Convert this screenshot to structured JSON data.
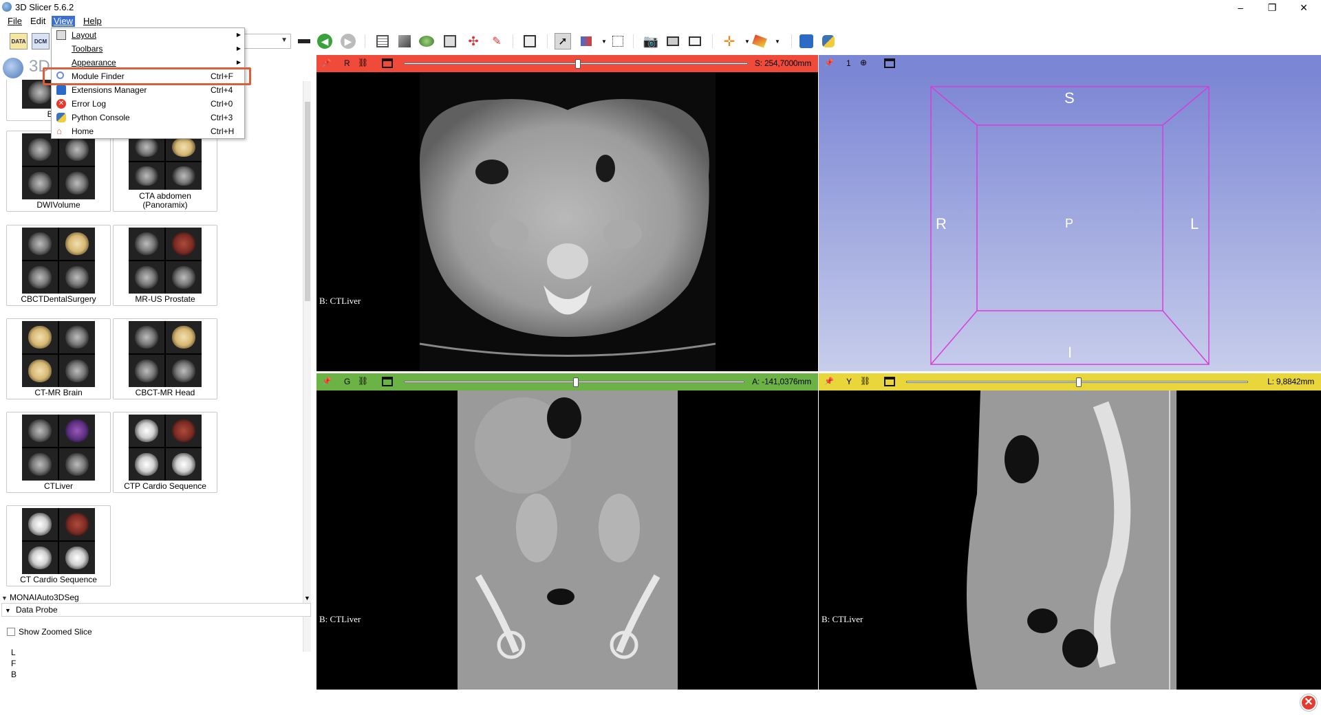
{
  "window": {
    "title": "3D Slicer 5.6.2",
    "minimize": "–",
    "maximize": "❐",
    "close": "✕"
  },
  "menubar": {
    "items": [
      {
        "label": "File"
      },
      {
        "label": "Edit"
      },
      {
        "label": "View"
      },
      {
        "label": "Help"
      }
    ]
  },
  "toolbar": {
    "data_icon": "DATA",
    "dcm_icon": "DCM"
  },
  "view_menu": {
    "items": [
      {
        "label": "Layout",
        "shortcut": "",
        "submenu": true,
        "icon": "layout-icon"
      },
      {
        "label": "Toolbars",
        "shortcut": "",
        "submenu": true,
        "icon": ""
      },
      {
        "label": "Appearance",
        "shortcut": "",
        "submenu": true,
        "icon": ""
      },
      {
        "label": "Module Finder",
        "shortcut": "Ctrl+F",
        "submenu": false,
        "icon": "search-icon"
      },
      {
        "label": "Extensions Manager",
        "shortcut": "Ctrl+4",
        "submenu": false,
        "icon": "extensions-icon"
      },
      {
        "label": "Error Log",
        "shortcut": "Ctrl+0",
        "submenu": false,
        "icon": "error-icon"
      },
      {
        "label": "Python Console",
        "shortcut": "Ctrl+3",
        "submenu": false,
        "icon": "python-icon"
      },
      {
        "label": "Home",
        "shortcut": "Ctrl+H",
        "submenu": false,
        "icon": "home-icon"
      }
    ]
  },
  "left_panel": {
    "module_title": "3D",
    "samples": [
      {
        "label": "Baseli"
      },
      {
        "label": "DWIVolume"
      },
      {
        "label": "CTA abdomen\n(Panoramix)"
      },
      {
        "label": "CBCTDentalSurgery"
      },
      {
        "label": "MR-US Prostate"
      },
      {
        "label": "CT-MR Brain"
      },
      {
        "label": "CBCT-MR Head"
      },
      {
        "label": "CTLiver"
      },
      {
        "label": "CTP Cardio Sequence"
      },
      {
        "label": "CT Cardio Sequence"
      }
    ],
    "monai_section": "MONAIAuto3DSeg",
    "data_probe": "Data Probe",
    "show_zoomed_slice": "Show Zoomed Slice",
    "probe_letters": [
      "L",
      "F",
      "B"
    ]
  },
  "viewers": {
    "red": {
      "letter": "R",
      "readout": "S: 254,7000mm",
      "label": "B: CTLiver",
      "color": "#f04b3a",
      "slider_fraction": 0.5
    },
    "threeD": {
      "letter": "1",
      "color": "#7b86d4",
      "orient": {
        "top": "S",
        "bottom": "I",
        "left": "R",
        "right": "L",
        "center": "P"
      }
    },
    "green": {
      "letter": "G",
      "readout": "A: -141,0376mm",
      "label": "B: CTLiver",
      "color": "#6bb344",
      "slider_fraction": 0.5
    },
    "yellow": {
      "letter": "Y",
      "readout": "L: 9,8842mm",
      "label": "B: CTLiver",
      "color": "#e9d63a",
      "slider_fraction": 0.5
    }
  },
  "status": {
    "close_error": "✕"
  }
}
